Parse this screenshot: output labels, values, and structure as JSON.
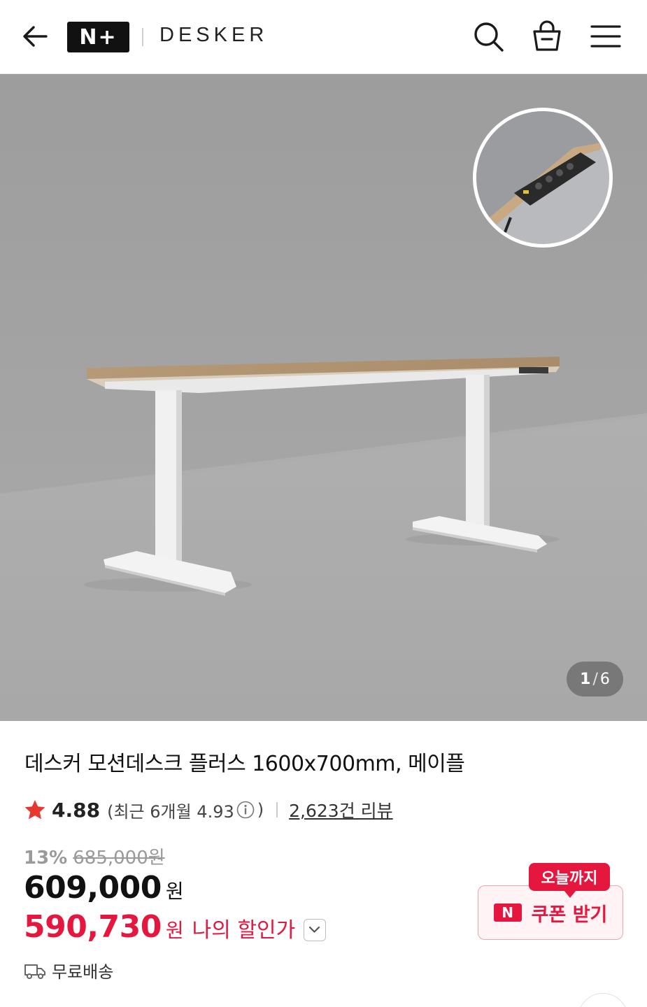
{
  "header": {
    "logo": "N+",
    "brand": "DESKER"
  },
  "hero": {
    "counter_current": "1",
    "counter_separator": "/",
    "counter_total": "6"
  },
  "product": {
    "title": "데스커 모션데스크 플러스 1600x700mm, 메이플",
    "rating": "4.88",
    "recent_open": "(최근 6개월 4.93",
    "recent_close": ")",
    "reviews": "2,623건 리뷰",
    "discount_rate": "13%",
    "original_price": "685,000원",
    "price": "609,000",
    "price_unit": "원",
    "my_price": "590,730",
    "my_price_unit": "원",
    "my_price_label": "나의 할인가",
    "shipping": "무료배송"
  },
  "coupon": {
    "tag": "오늘까지",
    "badge": "N",
    "label": "쿠폰 받기"
  },
  "colors": {
    "accent_red": "#e5173f",
    "star": "#e8372e"
  }
}
